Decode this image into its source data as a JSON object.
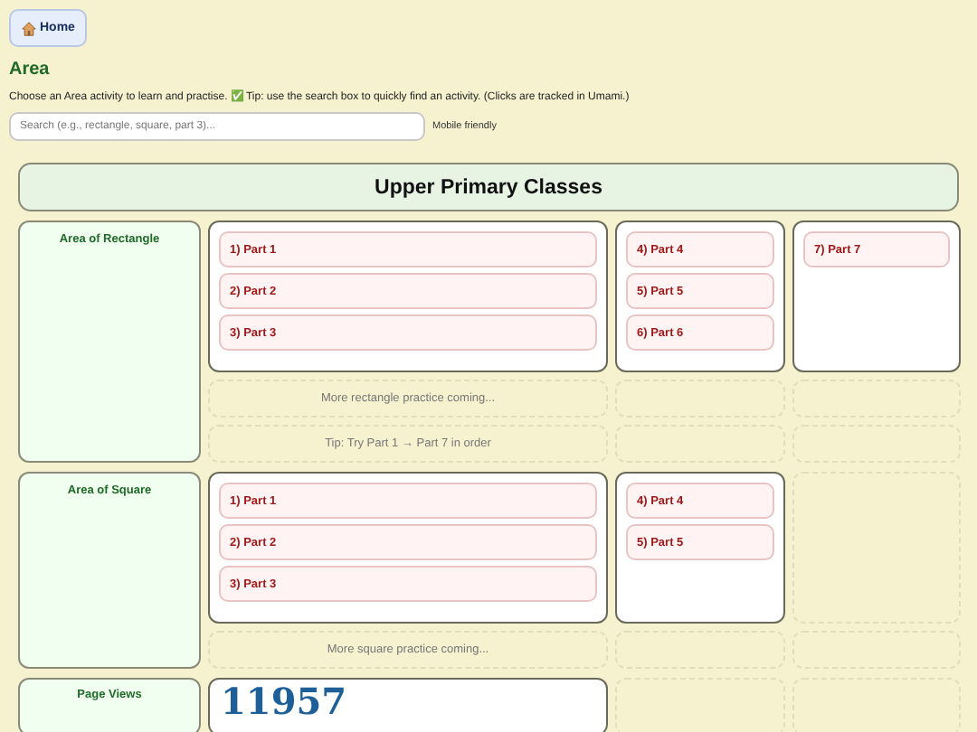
{
  "home_button": {
    "label": "Home"
  },
  "heading": "Area",
  "intro": "Choose an Area activity to learn and practise. ✅ Tip: use the search box to quickly find an activity. (Clicks are tracked in Umami.)",
  "search": {
    "placeholder": "Search (e.g., rectangle, square, part 3)..."
  },
  "search_note": "Mobile friendly",
  "section": {
    "title": "Upper Primary Classes"
  },
  "groups": [
    {
      "label": "Area of Rectangle",
      "columns": [
        [
          "1) Part 1",
          "2) Part 2",
          "3) Part 3"
        ],
        [
          "4) Part 4",
          "5) Part 5",
          "6) Part 6"
        ],
        [
          "7) Part 7"
        ]
      ],
      "notes": [
        "More rectangle practice coming...",
        "Tip: Try Part 1 → Part 7 in order"
      ]
    },
    {
      "label": "Area of Square",
      "columns": [
        [
          "1) Part 1",
          "2) Part 2",
          "3) Part 3"
        ],
        [
          "4) Part 4",
          "5) Part 5"
        ]
      ],
      "notes": [
        "More square practice coming..."
      ]
    }
  ],
  "page_views": {
    "label": "Page Views",
    "count": "11957"
  }
}
